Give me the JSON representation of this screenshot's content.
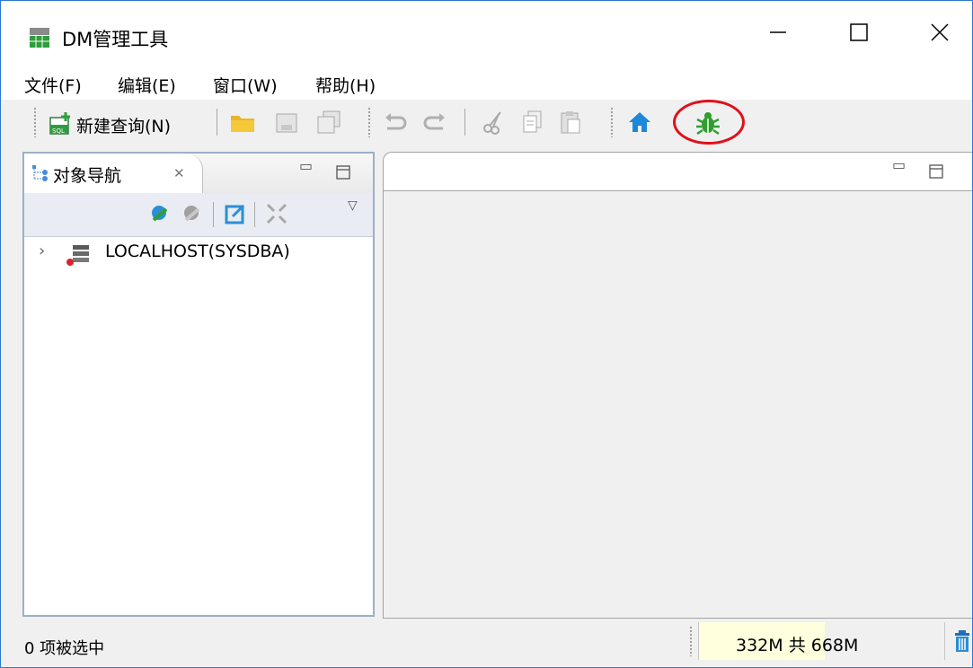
{
  "window": {
    "title": "DM管理工具",
    "controls": [
      "minimize-icon",
      "maximize-icon",
      "close-icon"
    ]
  },
  "menubar": {
    "items": [
      {
        "label": "文件(F)"
      },
      {
        "label": "编辑(E)"
      },
      {
        "label": "窗口(W)"
      },
      {
        "label": "帮助(H)"
      }
    ]
  },
  "toolbar": {
    "new_query_label": "新建查询(N)",
    "icons": [
      "sql-new-query-icon",
      "open-folder-icon",
      "save-icon",
      "save-all-icon",
      "undo-icon",
      "redo-icon",
      "cut-icon",
      "copy-icon",
      "paste-icon",
      "home-icon",
      "debug-bug-icon"
    ]
  },
  "navigator": {
    "tab_label": "对象导航",
    "toolbar_icons": [
      "connect-icon",
      "disconnect-icon",
      "edit-icon",
      "collapse-all-icon",
      "view-menu-icon"
    ],
    "tree": [
      {
        "label": "LOCALHOST(SYSDBA)",
        "expanded": false
      }
    ]
  },
  "statusbar": {
    "selection": "0 项被选中",
    "memory": "332M 共 668M"
  },
  "colors": {
    "window_border": "#2b79d1",
    "highlight_circle": "#e0101a",
    "bug_icon": "#2f9e2f",
    "home_icon": "#1e88d8",
    "memory_bg": "#ffffdd"
  }
}
